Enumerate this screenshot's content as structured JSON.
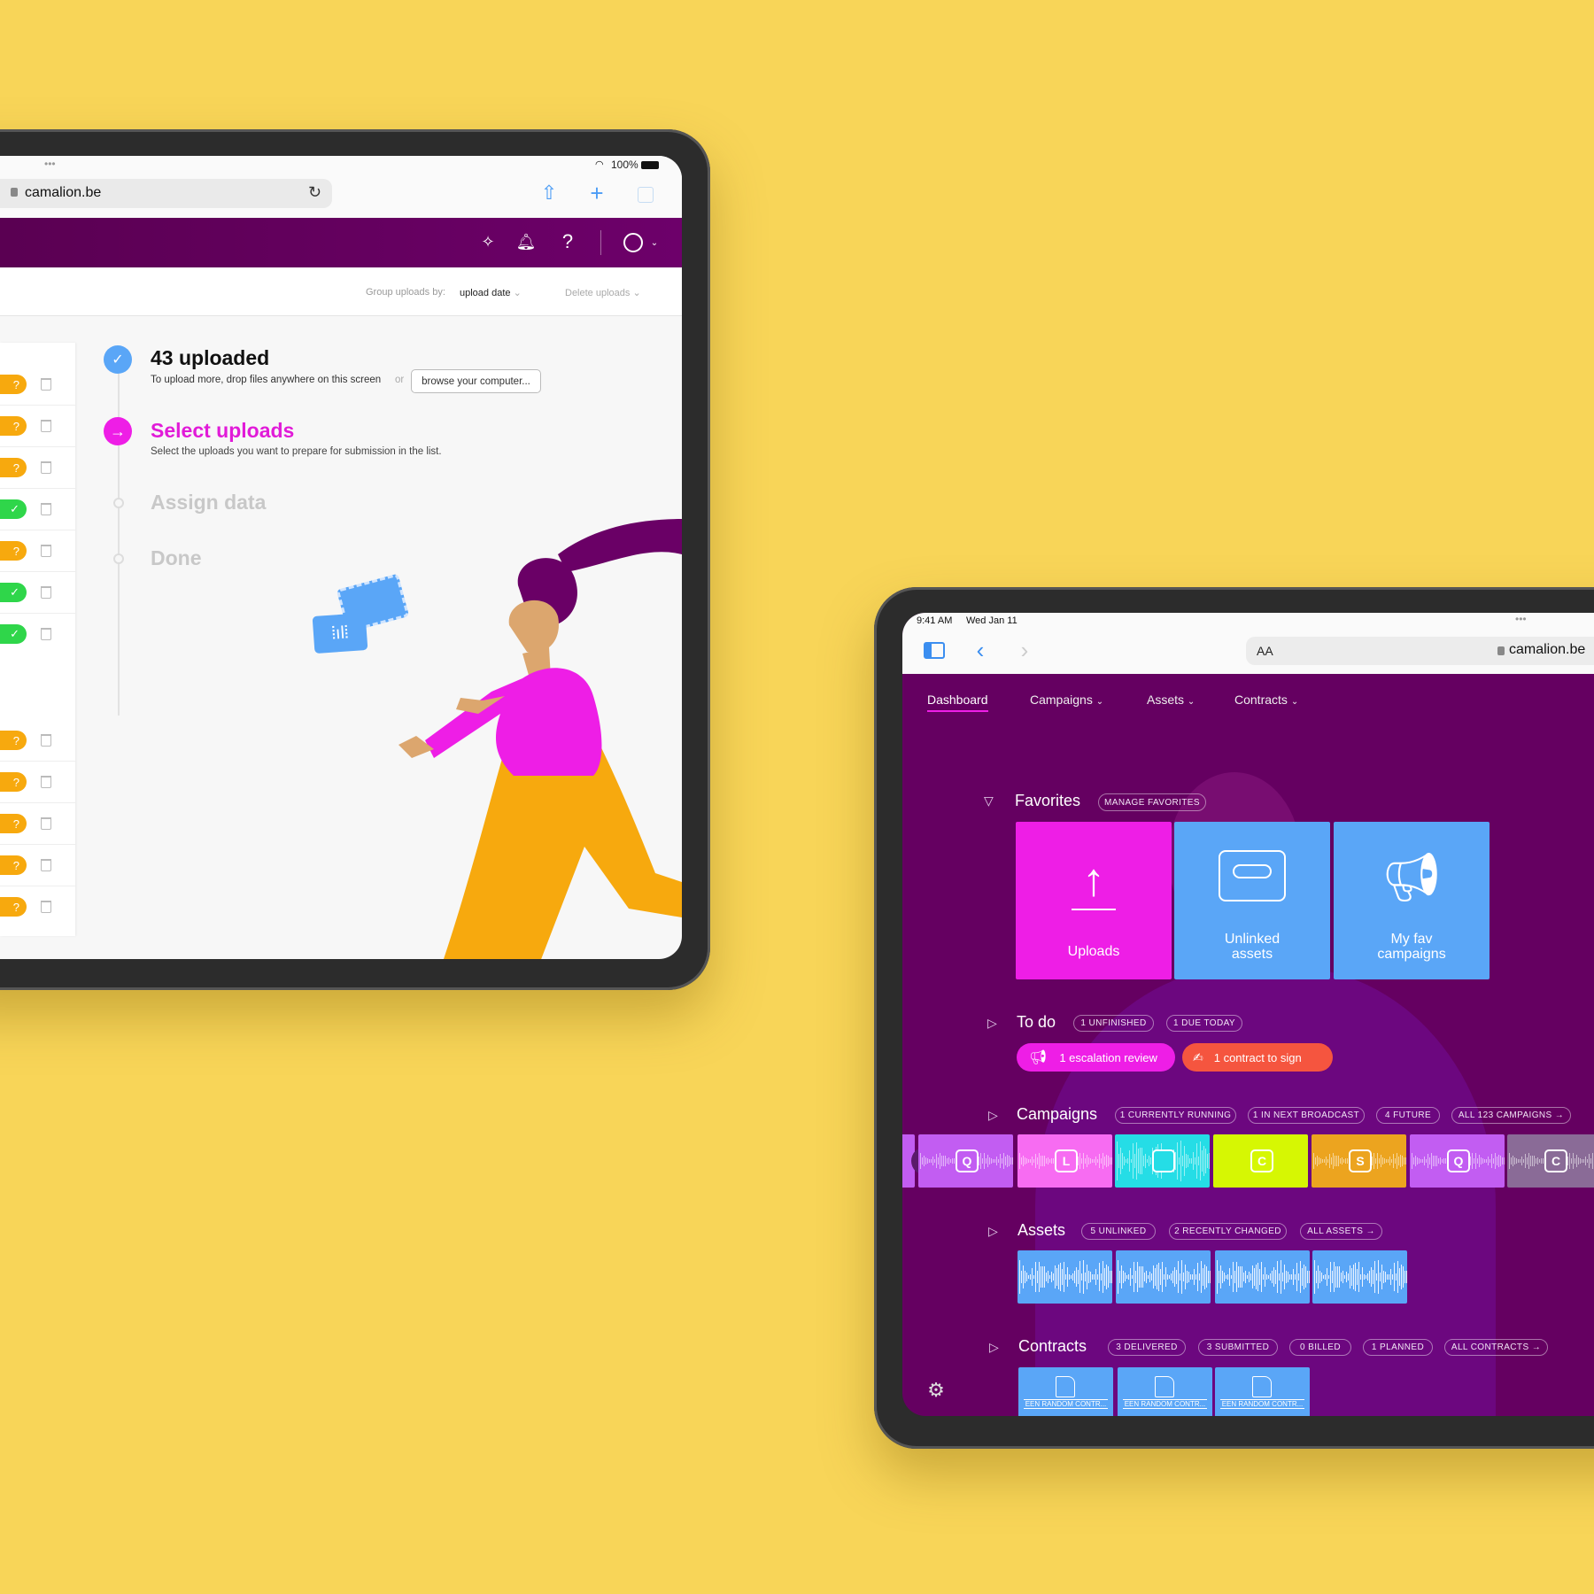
{
  "colors": {
    "background": "#f8d558",
    "purple": "#650061",
    "magenta": "#ee1ee6",
    "blue": "#5aa6f7",
    "orange": "#f7a90e",
    "green": "#2fd64a",
    "coral": "#f5553f"
  },
  "left_tablet": {
    "status": {
      "dots": "•••",
      "battery": "100%"
    },
    "browser": {
      "url": "camalion.be",
      "icons": [
        "lock-icon",
        "reload-icon",
        "share-icon",
        "plus-icon",
        "tabs-icon"
      ]
    },
    "header": {
      "icons": [
        "pin-icon",
        "bell-icon",
        "help-icon",
        "user-icon",
        "chevron-down-icon"
      ],
      "help_glyph": "?"
    },
    "toolbar": {
      "group_label": "Group uploads by:",
      "group_value": "upload date",
      "delete_label": "Delete uploads"
    },
    "upload_rows": [
      {
        "status": "unknown",
        "glyph": "?"
      },
      {
        "status": "unknown",
        "glyph": "?"
      },
      {
        "status": "unknown",
        "glyph": "?"
      },
      {
        "status": "ok",
        "glyph": "✓"
      },
      {
        "status": "unknown",
        "glyph": "?"
      },
      {
        "status": "ok",
        "glyph": "✓"
      },
      {
        "status": "ok",
        "glyph": "✓"
      },
      {
        "status": "unknown",
        "glyph": "?"
      },
      {
        "status": "unknown",
        "glyph": "?"
      },
      {
        "status": "unknown",
        "glyph": "?"
      },
      {
        "status": "unknown",
        "glyph": "?"
      },
      {
        "status": "unknown",
        "glyph": "?"
      }
    ],
    "steps": [
      {
        "title": "43 uploaded",
        "text": "To upload more, drop files anywhere on this screen",
        "or": "or",
        "button": "browse your computer...",
        "state": "done"
      },
      {
        "title": "Select uploads",
        "text": "Select the uploads you want to prepare for submission in the list.",
        "state": "active"
      },
      {
        "title": "Assign data",
        "state": "pending"
      },
      {
        "title": "Done",
        "state": "pending"
      }
    ]
  },
  "right_tablet": {
    "status": {
      "time": "9:41 AM",
      "date": "Wed Jan 11",
      "dots": "•••"
    },
    "browser": {
      "text_size": "AA",
      "url": "camalion.be"
    },
    "nav": [
      {
        "label": "Dashboard",
        "active": true
      },
      {
        "label": "Campaigns"
      },
      {
        "label": "Assets"
      },
      {
        "label": "Contracts"
      }
    ],
    "favorites": {
      "title": "Favorites",
      "pill": "MANAGE FAVORITES",
      "tiles": [
        {
          "label": "Uploads",
          "icon": "upload-icon",
          "color": "#ee1ee6"
        },
        {
          "label": "Unlinked assets",
          "icon": "cassette-icon",
          "color": "#5aa6f7"
        },
        {
          "label": "My fav campaigns",
          "icon": "megaphone-icon",
          "color": "#5aa6f7"
        }
      ]
    },
    "todo": {
      "title": "To do",
      "pills": [
        "1 UNFINISHED",
        "1 DUE TODAY"
      ],
      "actions": [
        {
          "label": "1 escalation review",
          "icon": "megaphone-icon",
          "color": "#ee1ee6"
        },
        {
          "label": "1 contract to sign",
          "icon": "signature-icon",
          "color": "#f5553f"
        }
      ]
    },
    "campaigns": {
      "title": "Campaigns",
      "pills": [
        "1 CURRENTLY RUNNING",
        "1 IN NEXT BROADCAST",
        "4 FUTURE",
        "ALL 123 CAMPAIGNS →"
      ],
      "tiles": [
        {
          "letter": "Q",
          "color": "#c25df2"
        },
        {
          "letter": "L",
          "color": "#f76cf2"
        },
        {
          "letter": "",
          "color": "#25dde6"
        },
        {
          "letter": "C",
          "color": "#d6f703"
        },
        {
          "letter": "S",
          "color": "#eca41f"
        },
        {
          "letter": "Q",
          "color": "#c25df2"
        },
        {
          "letter": "C",
          "color": "#8a6b97"
        }
      ]
    },
    "assets": {
      "title": "Assets",
      "pills": [
        "5 UNLINKED",
        "2 RECENTLY CHANGED",
        "ALL ASSETS →"
      ],
      "tile_count": 4
    },
    "contracts": {
      "title": "Contracts",
      "pills": [
        "3 DELIVERED",
        "3 SUBMITTED",
        "0 BILLED",
        "1 PLANNED",
        "ALL CONTRACTS →"
      ],
      "tiles": [
        "EEN RANDOM CONTR...",
        "EEN RANDOM CONTR...",
        "EEN RANDOM CONTR..."
      ]
    }
  }
}
